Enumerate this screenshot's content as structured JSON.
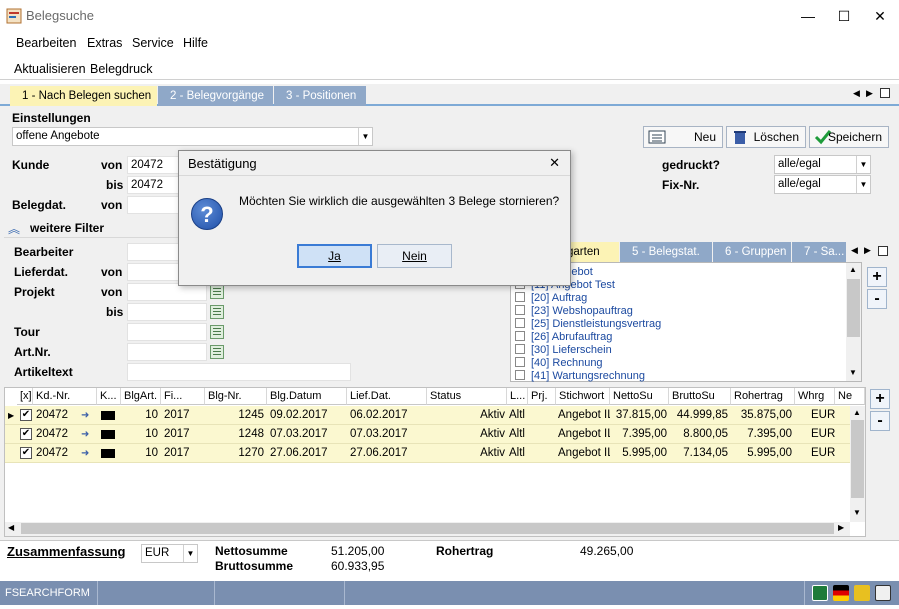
{
  "window": {
    "title": "Belegsuche",
    "minimize": "—",
    "maximize": "☐",
    "close": "✕"
  },
  "menu": [
    "Bearbeiten",
    "Extras",
    "Service",
    "Hilfe"
  ],
  "toolbar": [
    "Aktualisieren",
    "Belegdruck"
  ],
  "tabs": [
    "1 - Nach Belegen suchen",
    "2 - Belegvorgänge",
    "3 - Positionen"
  ],
  "settings": {
    "label": "Einstellungen",
    "value": "offene Angebote",
    "new_label": "Neu",
    "delete_label": "Löschen",
    "save_label": "Speichern"
  },
  "filters": {
    "kunde_label": "Kunde",
    "von_label": "von",
    "bis_label": "bis",
    "kunde_von": "20472",
    "kunde_bis": "20472",
    "belegdat_label": "Belegdat.",
    "gedruckt_label": "gedruckt?",
    "gedruckt_value": "alle/egal",
    "fixnr_label": "Fix-Nr.",
    "fixnr_value": "alle/egal"
  },
  "more_filters": {
    "title": "weitere Filter",
    "bearbeiter": "Bearbeiter",
    "lieferdat": "Lieferdat.",
    "projekt": "Projekt",
    "tour": "Tour",
    "artnr": "Art.Nr.",
    "artikeltext": "Artikeltext",
    "von": "von",
    "bis": "bis"
  },
  "right_tabs": [
    "4 - Belegarten",
    "5 - Belegstat.",
    "6 - Gruppen",
    "7 - Sa..."
  ],
  "right_tab_visible": "garten",
  "belegarten": [
    "[10] Angebot",
    "[11] Angebot Test",
    "[20] Auftrag",
    "[23] Webshopauftrag",
    "[25] Dienstleistungsvertrag",
    "[26] Abrufauftrag",
    "[30] Lieferschein",
    "[40] Rechnung",
    "[41] Wartungsrechnung"
  ],
  "grid": {
    "headers": [
      "[x]",
      "Kd.-Nr.",
      "K...",
      "BlgArt.",
      "Fi...",
      "Blg-Nr.",
      "Blg.Datum",
      "Lief.Dat.",
      "Status",
      "L...",
      "Prj.",
      "Stichwort",
      "NettoSu",
      "BruttoSu",
      "Rohertrag",
      "Whrg",
      "Ne"
    ],
    "rows": [
      {
        "check": "✔",
        "kdnr": "20472",
        "blgart": "10",
        "fi": "2017",
        "blgnr": "1245",
        "datum": "09.02.2017",
        "lief": "06.02.2017",
        "status": "Aktiv",
        "l": "Altl",
        "stich": "Angebot IL",
        "netto": "37.815,00",
        "brutto": "44.999,85",
        "roh": "35.875,00",
        "whrg": "EUR"
      },
      {
        "check": "✔",
        "kdnr": "20472",
        "blgart": "10",
        "fi": "2017",
        "blgnr": "1248",
        "datum": "07.03.2017",
        "lief": "07.03.2017",
        "status": "Aktiv",
        "l": "Altl",
        "stich": "Angebot IL",
        "netto": "7.395,00",
        "brutto": "8.800,05",
        "roh": "7.395,00",
        "whrg": "EUR"
      },
      {
        "check": "✔",
        "kdnr": "20472",
        "blgart": "10",
        "fi": "2017",
        "blgnr": "1270",
        "datum": "27.06.2017",
        "lief": "27.06.2017",
        "status": "Aktiv",
        "l": "Altl",
        "stich": "Angebot IL",
        "netto": "5.995,00",
        "brutto": "7.134,05",
        "roh": "5.995,00",
        "whrg": "EUR"
      }
    ]
  },
  "summary": {
    "title": "Zusammenfassung",
    "currency": "EUR",
    "netto_label": "Nettosumme",
    "netto_value": "51.205,00",
    "brutto_label": "Bruttosumme",
    "brutto_value": "60.933,95",
    "roh_label": "Rohertrag",
    "roh_value": "49.265,00"
  },
  "statusbar": {
    "form": "FSEARCHFORM"
  },
  "dialog": {
    "title": "Bestätigung",
    "message": "Möchten Sie wirklich die ausgewählten 3 Belege stornieren?",
    "yes": "Ja",
    "no": "Nein"
  }
}
